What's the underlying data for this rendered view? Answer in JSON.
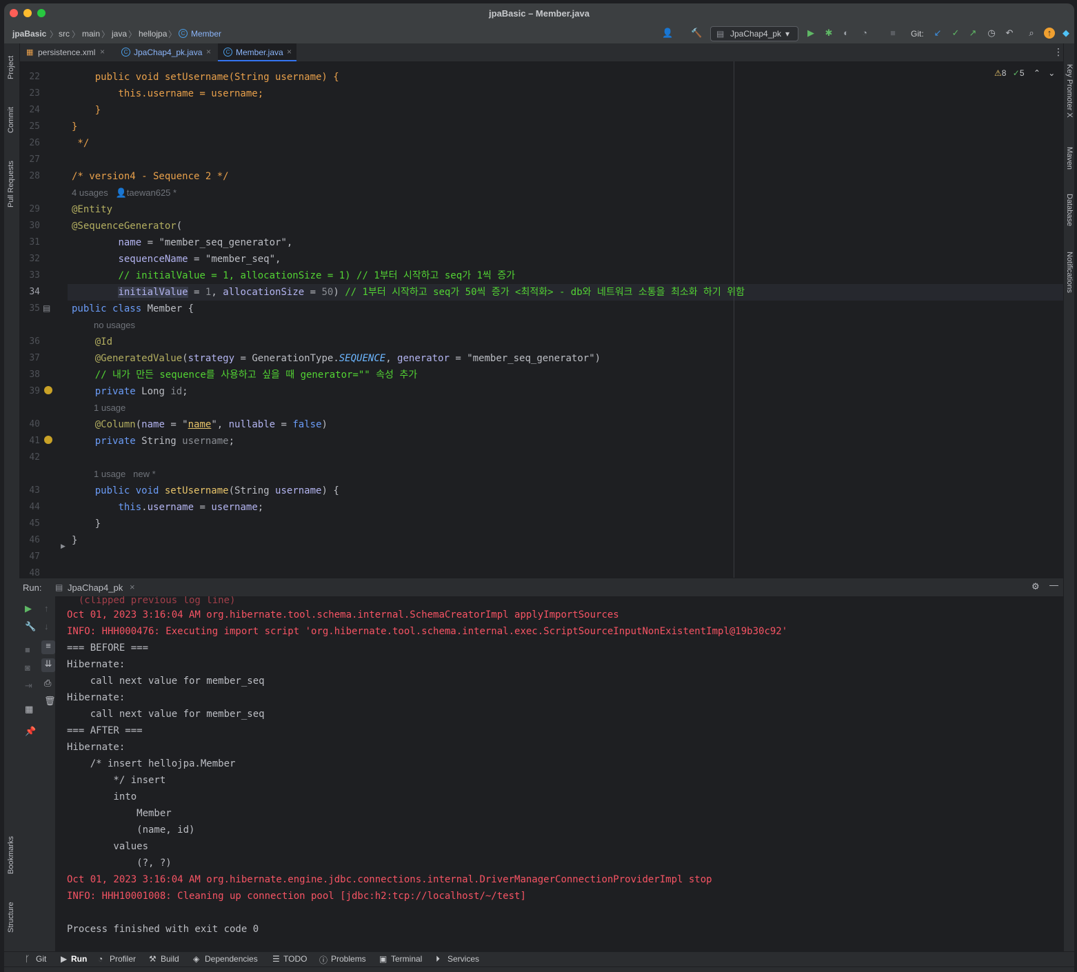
{
  "window": {
    "title": "jpaBasic – Member.java"
  },
  "breadcrumb": [
    "jpaBasic",
    "src",
    "main",
    "java",
    "hellojpa",
    "Member"
  ],
  "toolbar": {
    "run_config": "JpaChap4_pk",
    "git_label": "Git:"
  },
  "tabs": [
    {
      "label": "persistence.xml",
      "active": false
    },
    {
      "label": "JpaChap4_pk.java",
      "active": false
    },
    {
      "label": "Member.java",
      "active": true
    }
  ],
  "left_tools": {
    "project": "Project",
    "commit": "Commit",
    "pull_requests": "Pull Requests",
    "bookmarks": "Bookmarks",
    "structure": "Structure"
  },
  "right_tools": {
    "key_promoter": "Key Promoter X",
    "maven": "Maven",
    "database": "Database",
    "notifications": "Notifications"
  },
  "inspections": {
    "warnings": "8",
    "ok": "5"
  },
  "editor": {
    "line_numbers": [
      "22",
      "23",
      "24",
      "25",
      "26",
      "27",
      "28",
      "",
      "29",
      "30",
      "31",
      "32",
      "33",
      "34",
      "35",
      "",
      "36",
      "37",
      "38",
      "39",
      "",
      "40",
      "41",
      "42",
      "",
      "43",
      "44",
      "45",
      "46",
      "47",
      "48"
    ],
    "inlay_usages_1": "4 usages",
    "inlay_author": "taewan625 *",
    "inlay_no_usages": "no usages",
    "inlay_1usage_a": "1 usage",
    "inlay_1usage_b": "1 usage",
    "inlay_new": "new *",
    "comment_version4": "/* version4 - Sequence 2 */",
    "comment_alloc1": "// initialValue = 1, allocationSize = 1) // 1부터 시작하고 seq가 1씩 증가",
    "comment_alloc50": "// 1부터 시작하고 seq가 50씩 증가 <최적화> - db와 네트워크 소통을 최소화 하기 위함",
    "comment_generator": "// 내가 만든 sequence를 사용하고 싶을 때 generator=\"\" 속성 추가",
    "str_generator_name": "\"member_seq_generator\"",
    "str_sequence_name": "\"member_seq\"",
    "str_name": "name",
    "num_initial": "1",
    "num_alloc": "50"
  },
  "run_panel": {
    "label": "Run:",
    "config_tab": "JpaChap4_pk",
    "console_lines": [
      {
        "text": "Oct 01, 2023 3:16:04 AM org.hibernate.tool.schema.internal.SchemaCreatorImpl applyImportSources",
        "type": "err"
      },
      {
        "text": "INFO: HHH000476: Executing import script 'org.hibernate.tool.schema.internal.exec.ScriptSourceInputNonExistentImpl@19b30c92'",
        "type": "err"
      },
      {
        "text": "=== BEFORE ===",
        "type": "out"
      },
      {
        "text": "Hibernate: ",
        "type": "out"
      },
      {
        "text": "    call next value for member_seq",
        "type": "out"
      },
      {
        "text": "Hibernate: ",
        "type": "out"
      },
      {
        "text": "    call next value for member_seq",
        "type": "out"
      },
      {
        "text": "=== AFTER ===",
        "type": "out"
      },
      {
        "text": "Hibernate: ",
        "type": "out"
      },
      {
        "text": "    /* insert hellojpa.Member",
        "type": "out"
      },
      {
        "text": "        */ insert ",
        "type": "out"
      },
      {
        "text": "        into",
        "type": "out"
      },
      {
        "text": "            Member",
        "type": "out"
      },
      {
        "text": "            (name, id) ",
        "type": "out"
      },
      {
        "text": "        values",
        "type": "out"
      },
      {
        "text": "            (?, ?)",
        "type": "out"
      },
      {
        "text": "Oct 01, 2023 3:16:04 AM org.hibernate.engine.jdbc.connections.internal.DriverManagerConnectionProviderImpl stop",
        "type": "err"
      },
      {
        "text": "INFO: HHH10001008: Cleaning up connection pool [jdbc:h2:tcp://localhost/~/test]",
        "type": "err"
      },
      {
        "text": "",
        "type": "out"
      },
      {
        "text": "Process finished with exit code 0",
        "type": "out"
      }
    ]
  },
  "bottom_tabs": [
    "Git",
    "Run",
    "Profiler",
    "Build",
    "Dependencies",
    "TODO",
    "Problems",
    "Terminal",
    "Services"
  ],
  "colors": {
    "accent": "#3574f0",
    "error_text": "#f75464",
    "keyword": "#cf8e6d",
    "string": "#6aab73"
  }
}
